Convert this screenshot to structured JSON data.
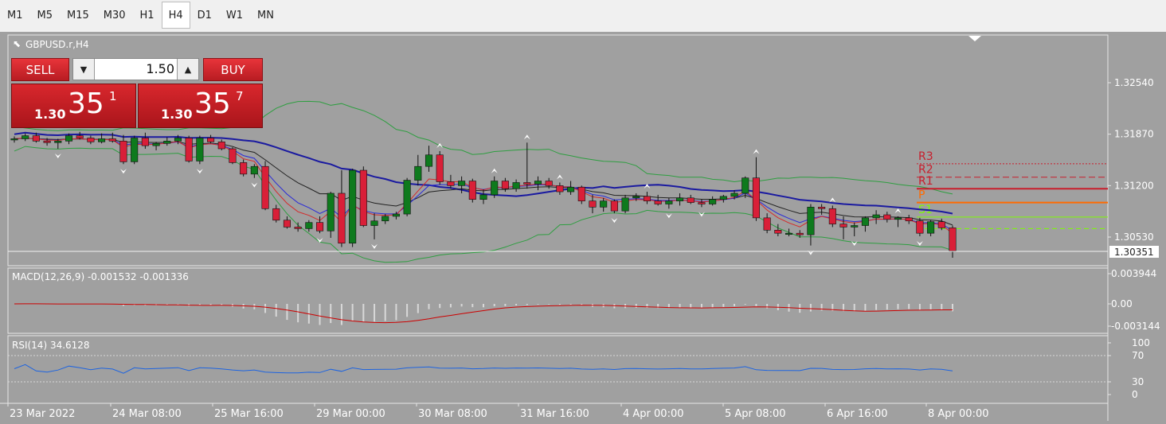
{
  "toolbar": {
    "timeframes": [
      "M1",
      "M5",
      "M15",
      "M30",
      "H1",
      "H4",
      "D1",
      "W1",
      "MN"
    ],
    "active": "H4"
  },
  "chart": {
    "title": "GBPUSD.r,H4",
    "price_labels": [
      "1.32540",
      "1.31870",
      "1.31200",
      "1.30530"
    ],
    "current_price": "1.30351",
    "time_labels": [
      "23 Mar 2022",
      "24 Mar 08:00",
      "25 Mar 16:00",
      "29 Mar 00:00",
      "30 Mar 08:00",
      "31 Mar 16:00",
      "4 Apr 00:00",
      "5 Apr 08:00",
      "6 Apr 16:00",
      "8 Apr 00:00"
    ],
    "pivot_labels": [
      "R3",
      "R2",
      "R1",
      "P",
      "S1"
    ],
    "colors": {
      "bull": "#0e7a1d",
      "bear": "#d91f38",
      "ma_blue": "#1a1aa0",
      "bollinger": "#2e9e40",
      "r": "#c81e2c",
      "pivot": "#ff6a00",
      "s": "#7cfc00",
      "macd_signal": "#cc0000",
      "rsi": "#1e64e0",
      "macd_hist": "#d8d8d8"
    }
  },
  "trade_panel": {
    "sell_label": "SELL",
    "buy_label": "BUY",
    "lot": "1.50",
    "sell_price": {
      "prefix": "1.30",
      "big": "35",
      "sup": "1"
    },
    "buy_price": {
      "prefix": "1.30",
      "big": "35",
      "sup": "7"
    }
  },
  "macd": {
    "label": "MACD(12,26,9) -0.001532 -0.001336",
    "scale": [
      "0.003944",
      "0.00",
      "-0.003144"
    ]
  },
  "rsi": {
    "label": "RSI(14) 34.6128",
    "scale": [
      "100",
      "70",
      "30",
      "0"
    ]
  },
  "chart_data": {
    "type": "candlestick",
    "symbol": "GBPUSD.r",
    "timeframe": "H4",
    "candles": [
      [
        1.318,
        1.3184,
        1.3176,
        1.3181
      ],
      [
        1.3181,
        1.3188,
        1.3178,
        1.3185
      ],
      [
        1.3185,
        1.3189,
        1.3176,
        1.3178
      ],
      [
        1.3178,
        1.3182,
        1.3172,
        1.3176
      ],
      [
        1.3176,
        1.3181,
        1.3168,
        1.3178
      ],
      [
        1.3178,
        1.3188,
        1.3174,
        1.3185
      ],
      [
        1.3185,
        1.319,
        1.318,
        1.3182
      ],
      [
        1.3182,
        1.3185,
        1.3174,
        1.3177
      ],
      [
        1.3177,
        1.3188,
        1.3175,
        1.3181
      ],
      [
        1.3181,
        1.3189,
        1.3176,
        1.3178
      ],
      [
        1.3178,
        1.3186,
        1.3148,
        1.3151
      ],
      [
        1.3151,
        1.3185,
        1.3148,
        1.3182
      ],
      [
        1.3182,
        1.3189,
        1.3168,
        1.3172
      ],
      [
        1.3172,
        1.3177,
        1.3166,
        1.3175
      ],
      [
        1.3175,
        1.3183,
        1.3172,
        1.3178
      ],
      [
        1.3178,
        1.3186,
        1.3174,
        1.3182
      ],
      [
        1.3182,
        1.3185,
        1.315,
        1.3152
      ],
      [
        1.3152,
        1.3185,
        1.3148,
        1.3182
      ],
      [
        1.3182,
        1.3186,
        1.3175,
        1.3177
      ],
      [
        1.3177,
        1.318,
        1.3166,
        1.3168
      ],
      [
        1.3168,
        1.317,
        1.3148,
        1.315
      ],
      [
        1.315,
        1.3154,
        1.3132,
        1.3135
      ],
      [
        1.3135,
        1.3148,
        1.313,
        1.3145
      ],
      [
        1.3145,
        1.3152,
        1.3088,
        1.309
      ],
      [
        1.309,
        1.3095,
        1.3072,
        1.3075
      ],
      [
        1.3075,
        1.308,
        1.3064,
        1.3066
      ],
      [
        1.3066,
        1.3072,
        1.306,
        1.3064
      ],
      [
        1.3064,
        1.3075,
        1.306,
        1.3072
      ],
      [
        1.3072,
        1.308,
        1.3058,
        1.3061
      ],
      [
        1.3061,
        1.3112,
        1.3052,
        1.311
      ],
      [
        1.311,
        1.314,
        1.304,
        1.3045
      ],
      [
        1.3045,
        1.3142,
        1.304,
        1.314
      ],
      [
        1.314,
        1.3145,
        1.3066,
        1.3068
      ],
      [
        1.3068,
        1.3084,
        1.305,
        1.3074
      ],
      [
        1.3074,
        1.3083,
        1.307,
        1.308
      ],
      [
        1.308,
        1.3086,
        1.3076,
        1.3083
      ],
      [
        1.3083,
        1.313,
        1.308,
        1.3127
      ],
      [
        1.3127,
        1.316,
        1.312,
        1.3145
      ],
      [
        1.3145,
        1.3172,
        1.3138,
        1.316
      ],
      [
        1.316,
        1.3165,
        1.3121,
        1.3125
      ],
      [
        1.3125,
        1.3134,
        1.3116,
        1.312
      ],
      [
        1.312,
        1.3132,
        1.311,
        1.3126
      ],
      [
        1.3126,
        1.3129,
        1.3098,
        1.3102
      ],
      [
        1.3102,
        1.3115,
        1.3096,
        1.3108
      ],
      [
        1.3108,
        1.3132,
        1.3104,
        1.3126
      ],
      [
        1.3126,
        1.313,
        1.3112,
        1.3116
      ],
      [
        1.3116,
        1.3128,
        1.3112,
        1.3124
      ],
      [
        1.3124,
        1.3176,
        1.3116,
        1.3122
      ],
      [
        1.3122,
        1.3132,
        1.3114,
        1.3126
      ],
      [
        1.3126,
        1.313,
        1.3116,
        1.312
      ],
      [
        1.312,
        1.3124,
        1.3108,
        1.3112
      ],
      [
        1.3112,
        1.3126,
        1.3108,
        1.3118
      ],
      [
        1.3118,
        1.312,
        1.3096,
        1.31
      ],
      [
        1.31,
        1.3108,
        1.3084,
        1.3092
      ],
      [
        1.3092,
        1.3104,
        1.3086,
        1.31
      ],
      [
        1.31,
        1.3102,
        1.3084,
        1.3087
      ],
      [
        1.3087,
        1.3108,
        1.3084,
        1.3104
      ],
      [
        1.3104,
        1.311,
        1.31,
        1.3106
      ],
      [
        1.3106,
        1.3112,
        1.3096,
        1.31
      ],
      [
        1.31,
        1.3108,
        1.3094,
        1.3096
      ],
      [
        1.3096,
        1.3104,
        1.309,
        1.31
      ],
      [
        1.31,
        1.311,
        1.3094,
        1.3104
      ],
      [
        1.3104,
        1.3108,
        1.3096,
        1.3098
      ],
      [
        1.3098,
        1.3102,
        1.3092,
        1.3096
      ],
      [
        1.3096,
        1.3106,
        1.3094,
        1.3102
      ],
      [
        1.3102,
        1.3108,
        1.3098,
        1.3106
      ],
      [
        1.3106,
        1.3114,
        1.3102,
        1.311
      ],
      [
        1.311,
        1.3132,
        1.3104,
        1.313
      ],
      [
        1.313,
        1.3157,
        1.3074,
        1.3078
      ],
      [
        1.3078,
        1.3084,
        1.3058,
        1.3062
      ],
      [
        1.3062,
        1.307,
        1.3054,
        1.3058
      ],
      [
        1.3058,
        1.3064,
        1.3054,
        1.3058
      ],
      [
        1.3058,
        1.3062,
        1.3052,
        1.3056
      ],
      [
        1.3056,
        1.3096,
        1.3042,
        1.3092
      ],
      [
        1.3092,
        1.3096,
        1.3082,
        1.309
      ],
      [
        1.309,
        1.3094,
        1.3066,
        1.307
      ],
      [
        1.307,
        1.308,
        1.305,
        1.3066
      ],
      [
        1.3066,
        1.3072,
        1.3054,
        1.3068
      ],
      [
        1.3068,
        1.308,
        1.306,
        1.3078
      ],
      [
        1.3078,
        1.3088,
        1.307,
        1.3082
      ],
      [
        1.3082,
        1.3086,
        1.3072,
        1.3076
      ],
      [
        1.3076,
        1.308,
        1.3066,
        1.3078
      ],
      [
        1.3078,
        1.3082,
        1.307,
        1.3074
      ],
      [
        1.3074,
        1.3078,
        1.3054,
        1.3058
      ],
      [
        1.3058,
        1.3075,
        1.3054,
        1.3073
      ],
      [
        1.3073,
        1.3077,
        1.3062,
        1.3065
      ],
      [
        1.3065,
        1.3068,
        1.3026,
        1.3035
      ]
    ],
    "pivots": {
      "R3": 1.31485,
      "R2": 1.3131,
      "R1": 1.3116,
      "P": 1.3098,
      "S1": 1.3079,
      "S2": 1.3064
    }
  }
}
